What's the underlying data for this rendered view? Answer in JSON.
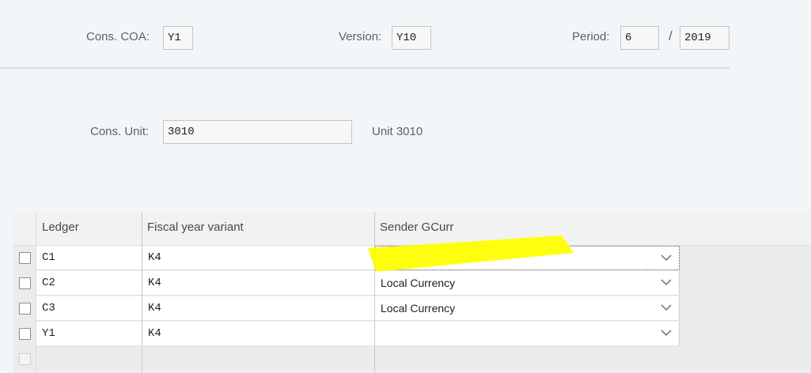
{
  "header": {
    "cons_coa": {
      "label": "Cons. COA:",
      "value": "Y1"
    },
    "version": {
      "label": "Version:",
      "value": "Y10"
    },
    "period": {
      "label": "Period:",
      "value": "6",
      "separator": "/",
      "year": "2019"
    },
    "cons_unit": {
      "label": "Cons. Unit:",
      "value": "3010",
      "description": "Unit 3010"
    }
  },
  "table": {
    "columns": [
      "Ledger",
      "Fiscal year variant",
      "Sender GCurr"
    ],
    "rows": [
      {
        "ledger": "C1",
        "fiscal_year_variant": "K4",
        "sender_gcurr": ""
      },
      {
        "ledger": "C2",
        "fiscal_year_variant": "K4",
        "sender_gcurr": "Local Currency"
      },
      {
        "ledger": "C3",
        "fiscal_year_variant": "K4",
        "sender_gcurr": "Local Currency"
      },
      {
        "ledger": "Y1",
        "fiscal_year_variant": "K4",
        "sender_gcurr": ""
      }
    ]
  },
  "highlight_color": "#ffff00"
}
